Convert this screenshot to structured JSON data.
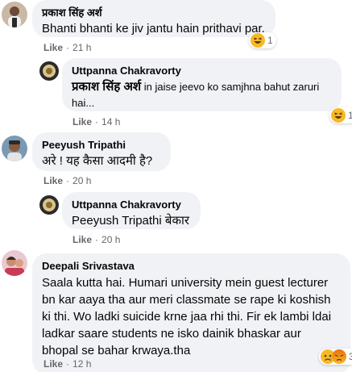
{
  "comments": [
    {
      "author": "प्रकाश सिंह अर्श",
      "text": "Bhanti bhanti ke jiv jantu hain prithavi par.",
      "like_label": "Like",
      "time": "21 h",
      "reaction_count": "1"
    },
    {
      "author": "Uttpanna Chakravorty",
      "mention": "प्रकाश सिंह अर्श",
      "text": "in jaise jeevo ko samjhna bahut zaruri hai...",
      "like_label": "Like",
      "time": "14 h",
      "reaction_count": "1"
    },
    {
      "author": "Peeyush Tripathi",
      "text": "अरे ! यह कैसा आदमी है?",
      "like_label": "Like",
      "time": "20 h"
    },
    {
      "author": "Uttpanna Chakravorty",
      "mention": "Peeyush Tripathi",
      "text": "बेकार",
      "like_label": "Like",
      "time": "20 h"
    },
    {
      "author": "Deepali Srivastava",
      "text": "Saala kutta hai. Humari university mein guest lecturer bn kar aaya tha aur meri classmate se rape ki koshish ki thi. Wo ladki suicide krne jaa rhi thi. Fir ek lambi ldai ladkar saare students ne isko dainik bhaskar aur bhopal se bahar krwaya.tha",
      "like_label": "Like",
      "time": "12 h",
      "reaction_count": "3"
    }
  ],
  "separator": "·",
  "icons": {
    "haha": "haha-emoji-icon",
    "sad": "sad-emoji-icon",
    "angry": "angry-emoji-icon"
  },
  "colors": {
    "bubble": "#f0f2f5",
    "meta": "#65676b",
    "reaction_yellow": "#f7b928",
    "angry_orange": "#e9710f"
  }
}
